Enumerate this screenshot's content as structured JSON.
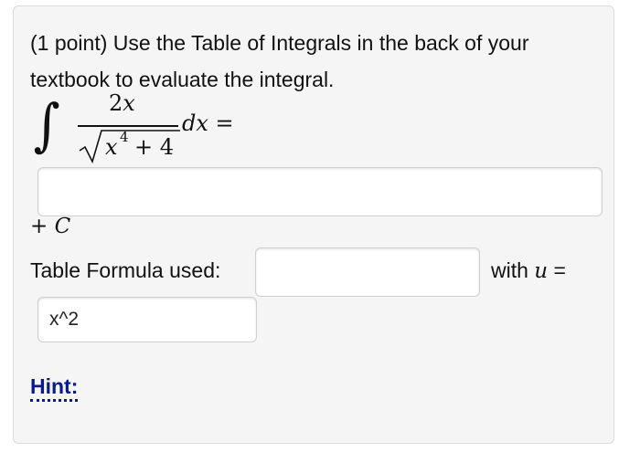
{
  "problem": {
    "text": "(1 point) Use the Table of Integrals in the back of your textbook to evaluate the integral."
  },
  "integral": {
    "sign": "∫",
    "numerator_coef": "2",
    "numerator_var": "x",
    "denominator_base": "x",
    "denominator_exp": "4",
    "denominator_rest": "+ 4",
    "dx": "dx",
    "equals": "="
  },
  "answer": {
    "value": "",
    "plus": "+",
    "constant": "C"
  },
  "formula": {
    "label": "Table Formula used:",
    "value": "",
    "with_label": "with",
    "u_var": "u",
    "equals": "="
  },
  "u_substitution": {
    "value": "x^2"
  },
  "hint": {
    "label": "Hint:"
  }
}
